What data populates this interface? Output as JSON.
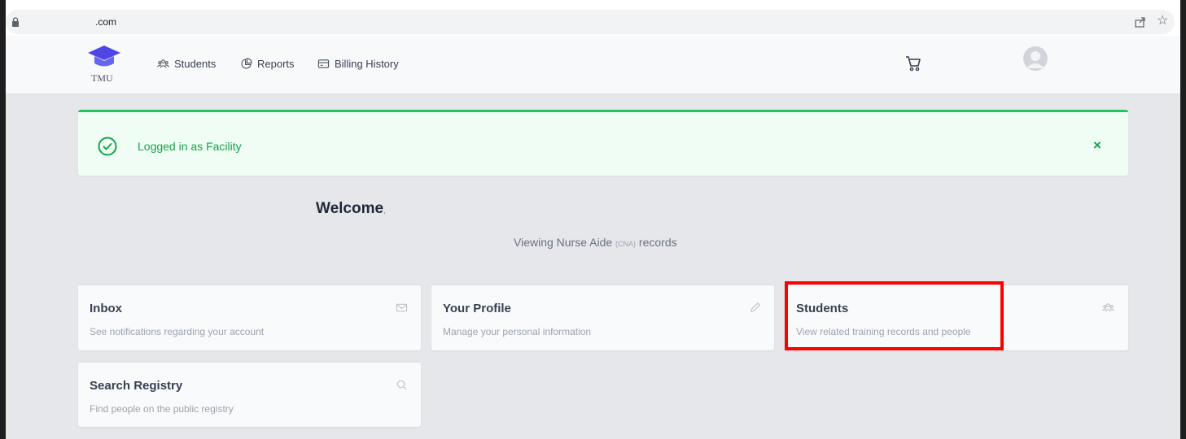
{
  "browser": {
    "url": ".com"
  },
  "nav": {
    "logo_text": "TMU",
    "items": [
      {
        "label": "Students",
        "icon": "people-icon"
      },
      {
        "label": "Reports",
        "icon": "chart-pie-icon"
      },
      {
        "label": "Billing History",
        "icon": "card-icon"
      }
    ]
  },
  "alert": {
    "message": "Logged in as Facility",
    "close": "×"
  },
  "welcome": {
    "title": "Welcome",
    "punctuation": ",",
    "subtitle_prefix": "Viewing Nurse Aide ",
    "subtitle_abbr": "(CNA)",
    "subtitle_suffix": " records"
  },
  "cards": [
    {
      "title": "Inbox",
      "description": "See notifications regarding your account",
      "icon": "mail-icon"
    },
    {
      "title": "Your Profile",
      "description": "Manage your personal information",
      "icon": "pencil-icon"
    },
    {
      "title": "Students",
      "description": "View related training records and people",
      "icon": "people-icon"
    },
    {
      "title": "Search Registry",
      "description": "Find people on the public registry",
      "icon": "search-icon"
    }
  ],
  "colors": {
    "success": "#22c55e",
    "success_text": "#16a34a",
    "highlight": "#ff0000"
  }
}
